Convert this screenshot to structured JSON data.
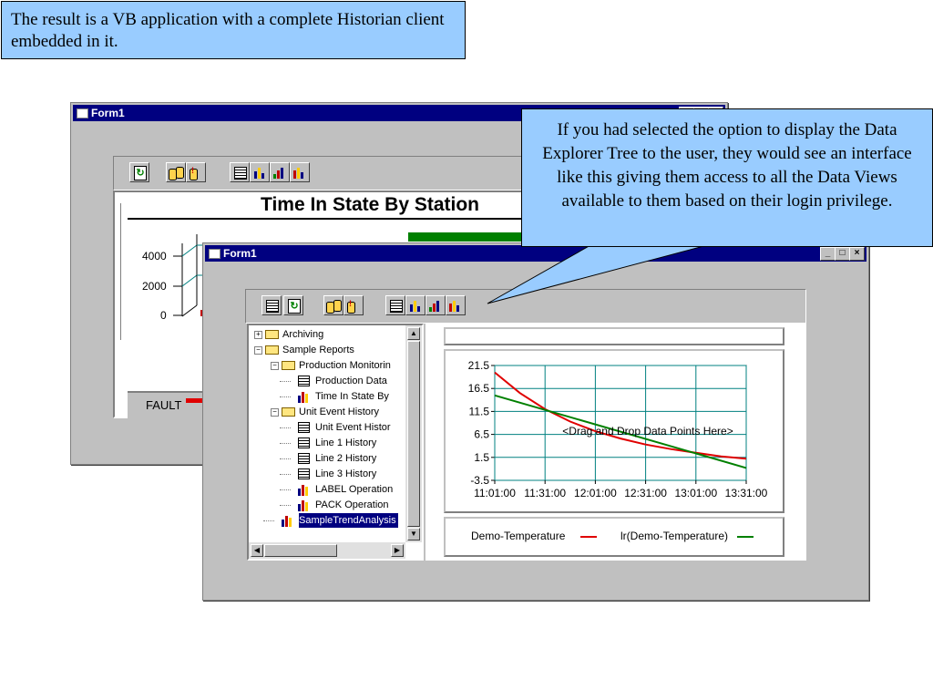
{
  "top_callout": {
    "text": "The result is a VB application with a complete Historian client embedded in it."
  },
  "side_callout": {
    "text": "If you had selected the option to display the Data Explorer Tree to the user, they would see an interface like this giving them access to all the Data Views available to them based on their login privilege."
  },
  "back_window": {
    "title": "Form1",
    "chart_title": "Time In State By Station",
    "y_ticks": [
      "4000",
      "2000",
      "0"
    ],
    "legend_item": "FAULT"
  },
  "front_window": {
    "title": "Form1",
    "title_buttons": [
      "_",
      "□",
      "×"
    ],
    "drop_hint": "<Drag and Drop Data Points Here>",
    "tree": [
      {
        "label": "Archiving",
        "icon": "folder-icon",
        "expander": "+",
        "level": 0
      },
      {
        "label": "Sample Reports",
        "icon": "folder-icon",
        "expander": "−",
        "level": 0
      },
      {
        "label": "Production Monitorin",
        "icon": "folder-icon",
        "expander": "−",
        "level": 1
      },
      {
        "label": "Production Data",
        "icon": "table-icon",
        "level": 2
      },
      {
        "label": "Time In State By",
        "icon": "bar-chart-icon",
        "level": 2
      },
      {
        "label": "Unit Event History",
        "icon": "folder-icon",
        "expander": "−",
        "level": 1
      },
      {
        "label": "Unit Event Histor",
        "icon": "table-icon",
        "level": 2
      },
      {
        "label": "Line 1 History",
        "icon": "table-icon",
        "level": 2
      },
      {
        "label": "Line 2 History",
        "icon": "table-icon",
        "level": 2
      },
      {
        "label": "Line 3 History",
        "icon": "table-icon",
        "level": 2
      },
      {
        "label": "LABEL Operation",
        "icon": "bar-chart-icon",
        "level": 2
      },
      {
        "label": "PACK Operation",
        "icon": "bar-chart-icon",
        "level": 2
      },
      {
        "label": "SampleTrendAnalysis",
        "icon": "bar-chart-icon",
        "level": 1,
        "selected": true
      }
    ]
  },
  "chart_data": {
    "type": "line",
    "title": "",
    "xlabel": "",
    "ylabel": "",
    "x_ticks": [
      "11:01:00",
      "11:31:00",
      "12:01:00",
      "12:31:00",
      "13:01:00",
      "13:31:00"
    ],
    "y_ticks": [
      "21.5",
      "16.5",
      "11.5",
      "6.5",
      "1.5",
      "-3.5"
    ],
    "xlim": [
      "11:01:00",
      "13:31:00"
    ],
    "ylim": [
      -3.5,
      21.5
    ],
    "grid": true,
    "legend_position": "bottom",
    "series": [
      {
        "name": "Demo-Temperature",
        "color": "#e00000",
        "x": [
          "11:01:00",
          "11:16:00",
          "11:31:00",
          "11:46:00",
          "12:01:00",
          "12:16:00",
          "12:31:00",
          "12:46:00",
          "13:01:00",
          "13:16:00",
          "13:31:00"
        ],
        "y": [
          20,
          15.5,
          12,
          9.3,
          7.2,
          5.6,
          4.3,
          3.3,
          2.5,
          1.7,
          1.2
        ]
      },
      {
        "name": "lr(Demo-Temperature)",
        "color": "#008000",
        "x": [
          "11:01:00",
          "13:31:00"
        ],
        "y": [
          15,
          -0.8
        ]
      }
    ]
  }
}
